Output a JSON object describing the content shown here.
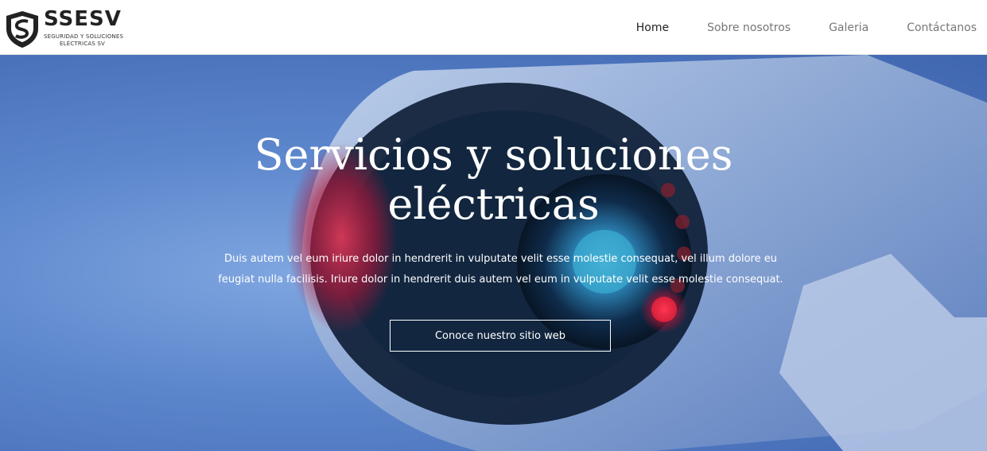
{
  "brand": {
    "name": "SSESV",
    "tagline_line1": "SEGURIDAD Y SOLUCIONES",
    "tagline_line2": "ELÉCTRICAS SV",
    "logo_icon": "shield-icon"
  },
  "nav": {
    "items": [
      {
        "label": "Home",
        "active": true
      },
      {
        "label": "Sobre nosotros",
        "active": false
      },
      {
        "label": "Galeria",
        "active": false
      },
      {
        "label": "Contáctanos",
        "active": false
      }
    ]
  },
  "hero": {
    "title_line1": "Servicios y soluciones",
    "title_line2": "eléctricas",
    "description": "Duis autem vel eum iriure dolor in hendrerit in vulputate velit esse molestie consequat, vel illum dolore eu feugiat nulla facilisis. Iriure dolor in hendrerit duis autem vel eum in vulputate velit esse molestie consequat.",
    "button_label": "Conoce nuestro sitio web",
    "background_image": "security-camera-photo"
  },
  "colors": {
    "header_bg": "#ffffff",
    "nav_active": "#222222",
    "nav_inactive": "#777777",
    "hero_blue": "#5c86cc",
    "hero_text": "#ffffff"
  }
}
